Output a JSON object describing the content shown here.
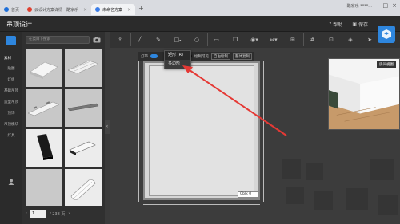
{
  "browser": {
    "tabs": [
      {
        "label": "首页"
      },
      {
        "label": "云设计方案详情 - 酷家乐"
      },
      {
        "label": "未命名方案",
        "active": true
      }
    ],
    "new_tab": "+",
    "user": "酷家乐 ****..."
  },
  "header": {
    "title": "吊顶设计",
    "help": "帮助",
    "save": "保存"
  },
  "rail": {
    "section": "素材",
    "items": [
      "贴图",
      "灯组",
      "基础吊顶",
      "造型吊顶",
      "顶饰",
      "吊顶模块",
      "灯具"
    ]
  },
  "panel": {
    "search_placeholder": "在类目下搜索",
    "page_current": "1",
    "page_total": "/ 238 页"
  },
  "subbar": {
    "label1": "灯带",
    "label2": "顶灯",
    "label3": "绘制可见",
    "label4": "自由绘制",
    "label5": "整体复制"
  },
  "dropdown": {
    "items": [
      "矩形 (R)",
      "多边形"
    ]
  },
  "canvas": {
    "room_value": "Cblk 0",
    "preview_label": "房间视图"
  },
  "colors": {
    "accent": "#2e86de",
    "arrow": "#e53935"
  }
}
